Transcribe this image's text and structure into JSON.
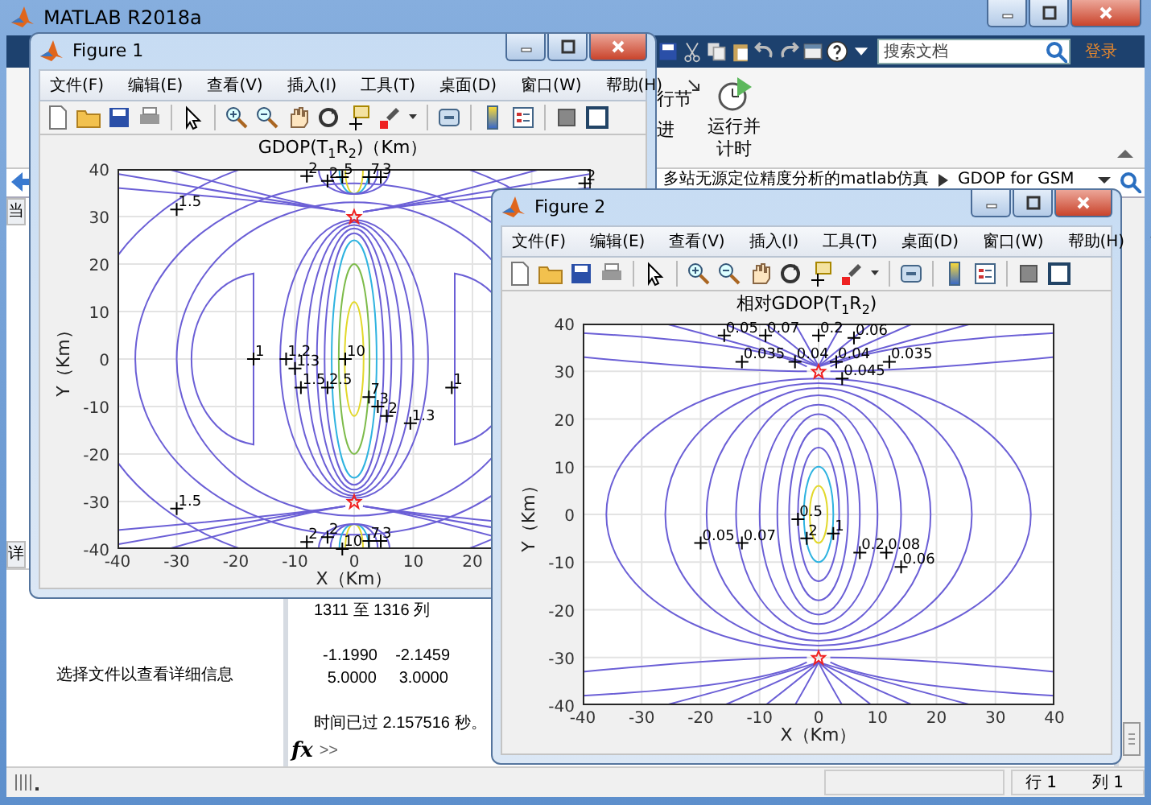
{
  "window": {
    "title": "MATLAB R2018a"
  },
  "quick_access": {
    "search": {
      "placeholder": "搜索文档"
    },
    "login": "登录"
  },
  "ribbon": {
    "items": [
      {
        "kind": "partial",
        "label": "行节"
      },
      {
        "kind": "partial",
        "label": "进"
      },
      {
        "kind": "button",
        "label": "运行并计时"
      }
    ]
  },
  "address_bar": {
    "path": [
      "多站无源定位精度分析的matlab仿真",
      "GDOP for GSM"
    ]
  },
  "left_panel": {
    "top_tab": "当",
    "details_tab": "详",
    "message": "选择文件以查看详细信息"
  },
  "command_window": {
    "lines": [
      {
        "kind": "text",
        "text": "1311 至 1316 列"
      },
      {
        "kind": "gap",
        "text": "  -1.1990    -2.1459"
      },
      {
        "kind": "text",
        "text": "   5.0000     3.0000"
      },
      {
        "kind": "gap",
        "text": "时间已过 2.157516 秒。"
      }
    ],
    "fx": "fx",
    "prompt": ">>"
  },
  "status_bar": {
    "row": "行 1",
    "column": "列 1"
  },
  "figures": [
    {
      "title": "Figure 1",
      "menu": [
        "文件(F)",
        "编辑(E)",
        "查看(V)",
        "插入(I)",
        "工具(T)",
        "桌面(D)",
        "窗口(W)",
        "帮助(H)"
      ],
      "plot": {
        "kind": "gdop",
        "title": "GDOP(T$_{1}$R$_{2}$)（Km）",
        "xlabel": "X（Km）",
        "ylabel": "Y（Km）",
        "xticks": [
          "-40",
          "-30",
          "-20",
          "-10",
          "0",
          "10",
          "20"
        ],
        "yticks": [
          "40",
          "30",
          "20",
          "10",
          "0",
          "-10",
          "-20",
          "-30",
          "-40"
        ],
        "labels": [
          "2",
          "2",
          "5",
          "7",
          "3",
          "2",
          "1.5",
          "1",
          "1.2",
          "1.3",
          "1.5",
          "2.5",
          "10",
          "7",
          "3",
          "2",
          "1.3",
          "1",
          "1.5",
          "2",
          "2",
          "10",
          "7",
          "3"
        ]
      }
    },
    {
      "title": "Figure 2",
      "menu": [
        "文件(F)",
        "编辑(E)",
        "查看(V)",
        "插入(I)",
        "工具(T)",
        "桌面(D)",
        "窗口(W)",
        "帮助(H)"
      ],
      "plot": {
        "kind": "relative",
        "title": "相对GDOP(T$_{1}$R$_{2}$)",
        "xlabel": "X（Km）",
        "ylabel": "Y（Km）",
        "xticks": [
          "-40",
          "-30",
          "-20",
          "-10",
          "0",
          "10",
          "20",
          "30",
          "40"
        ],
        "yticks": [
          "40",
          "30",
          "20",
          "10",
          "0",
          "-10",
          "-20",
          "-30",
          "-40"
        ],
        "labels": [
          "0.05",
          "0.07",
          "0.2",
          "0.06",
          "0.035",
          "0.04",
          "0.04",
          "0.035",
          "0.045",
          "0.05",
          "0.07",
          "0.5",
          "2",
          "1",
          "0.2",
          "0.08",
          "0.06"
        ]
      }
    }
  ]
}
